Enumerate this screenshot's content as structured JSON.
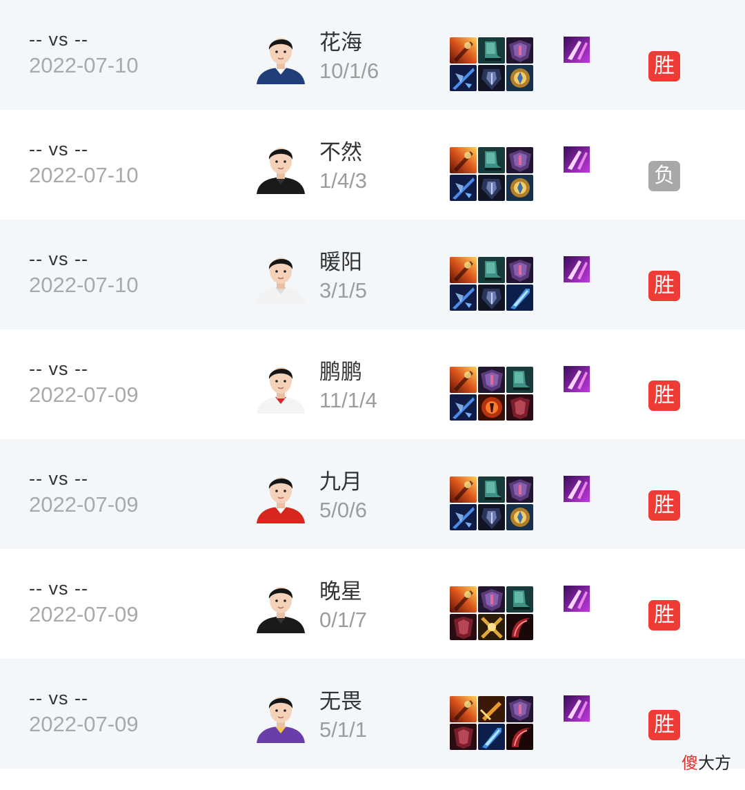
{
  "colors": {
    "win": "#ee3b35",
    "loss": "#a8a8a8",
    "row_alt": "#f3f7f9"
  },
  "matches": [
    {
      "vs": "-- vs --",
      "date": "2022-07-10",
      "player": "花海",
      "kda": "10/1/6",
      "result": "胜",
      "outcome": "win",
      "items": [
        "fire-blade-icon",
        "green-boots-icon",
        "purple-armor-icon",
        "blue-spear-icon",
        "dark-armor-icon",
        "gold-shield-icon"
      ],
      "spell": "purple-flash-icon",
      "avatar": "player-avatar-blue"
    },
    {
      "vs": "-- vs --",
      "date": "2022-07-10",
      "player": "不然",
      "kda": "1/4/3",
      "result": "负",
      "outcome": "loss",
      "items": [
        "fire-blade-icon",
        "green-boots-icon",
        "purple-armor-icon",
        "blue-spear-icon",
        "dark-armor-icon",
        "gold-shield-icon"
      ],
      "spell": "purple-flash-icon",
      "avatar": "player-avatar-black"
    },
    {
      "vs": "-- vs --",
      "date": "2022-07-10",
      "player": "暖阳",
      "kda": "3/1/5",
      "result": "胜",
      "outcome": "win",
      "items": [
        "fire-blade-icon",
        "green-boots-icon",
        "purple-armor-icon",
        "blue-spear-icon",
        "dark-armor-icon",
        "blue-blade-icon"
      ],
      "spell": "purple-flash-icon",
      "avatar": "player-avatar-white"
    },
    {
      "vs": "-- vs --",
      "date": "2022-07-09",
      "player": "鹏鹏",
      "kda": "11/1/4",
      "result": "胜",
      "outcome": "win",
      "items": [
        "fire-blade-icon",
        "purple-armor-icon",
        "green-boots-icon",
        "blue-spear-icon",
        "red-orb-icon",
        "red-armor-icon"
      ],
      "spell": "purple-flash-icon",
      "avatar": "player-avatar-white-red"
    },
    {
      "vs": "-- vs --",
      "date": "2022-07-09",
      "player": "九月",
      "kda": "5/0/6",
      "result": "胜",
      "outcome": "win",
      "items": [
        "fire-blade-icon",
        "green-boots-icon",
        "purple-armor-icon",
        "blue-spear-icon",
        "dark-armor-icon",
        "gold-shield-icon"
      ],
      "spell": "purple-flash-icon",
      "avatar": "player-avatar-red"
    },
    {
      "vs": "-- vs --",
      "date": "2022-07-09",
      "player": "晚星",
      "kda": "0/1/7",
      "result": "胜",
      "outcome": "win",
      "items": [
        "fire-blade-icon",
        "purple-armor-icon",
        "green-boots-icon",
        "red-armor-icon",
        "gold-cross-icon",
        "red-horn-icon"
      ],
      "spell": "purple-flash-icon",
      "avatar": "player-avatar-black"
    },
    {
      "vs": "-- vs --",
      "date": "2022-07-09",
      "player": "无畏",
      "kda": "5/1/1",
      "result": "胜",
      "outcome": "win",
      "items": [
        "fire-blade-icon",
        "gold-sword-icon",
        "purple-armor-icon",
        "red-armor-icon",
        "blue-blade-icon",
        "red-horn-icon"
      ],
      "spell": "purple-flash-icon",
      "avatar": "player-avatar-purple"
    }
  ],
  "watermark": {
    "red": "傻",
    "rest": "大方"
  }
}
